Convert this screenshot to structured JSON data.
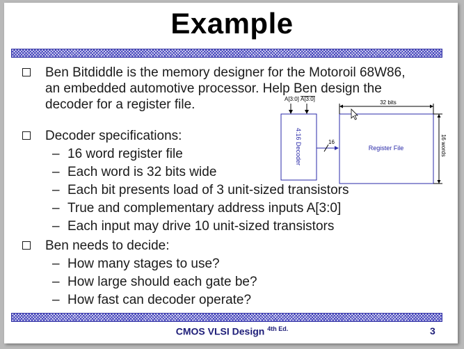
{
  "slide": {
    "title": "Example",
    "bullets": [
      {
        "lines": [
          "Ben Bitdiddle is the memory designer for the Motoroil 68W86,",
          "an embedded automotive processor.  Help Ben design the",
          "decoder for a register file."
        ]
      },
      {
        "lines": [
          "Decoder specifications:"
        ],
        "subitems": [
          "16 word register file",
          "Each word is 32 bits wide",
          "Each bit presents load of 3 unit-sized transistors",
          "True and complementary address inputs A[3:0]",
          "Each input may drive 10 unit-sized transistors"
        ]
      },
      {
        "lines": [
          "Ben needs to decide:"
        ],
        "subitems": [
          "How many stages to use?",
          "How large should each gate be?",
          "How fast can decoder operate?"
        ]
      }
    ],
    "diagram": {
      "input_a": "A[3:0]",
      "input_a_bar": "A[3:0]",
      "decoder_label": "4:16 Decoder",
      "bus_width": "16",
      "register_label": "Register File",
      "width_label": "32 bits",
      "height_label": "16 words"
    },
    "footer": {
      "course": "CMOS VLSI Design",
      "edition": "4th Ed.",
      "page": "3"
    }
  },
  "colors": {
    "stripe": "#3a3ab8",
    "footer_text": "#1d1d78",
    "diagram_blue": "#2a2aa8"
  }
}
